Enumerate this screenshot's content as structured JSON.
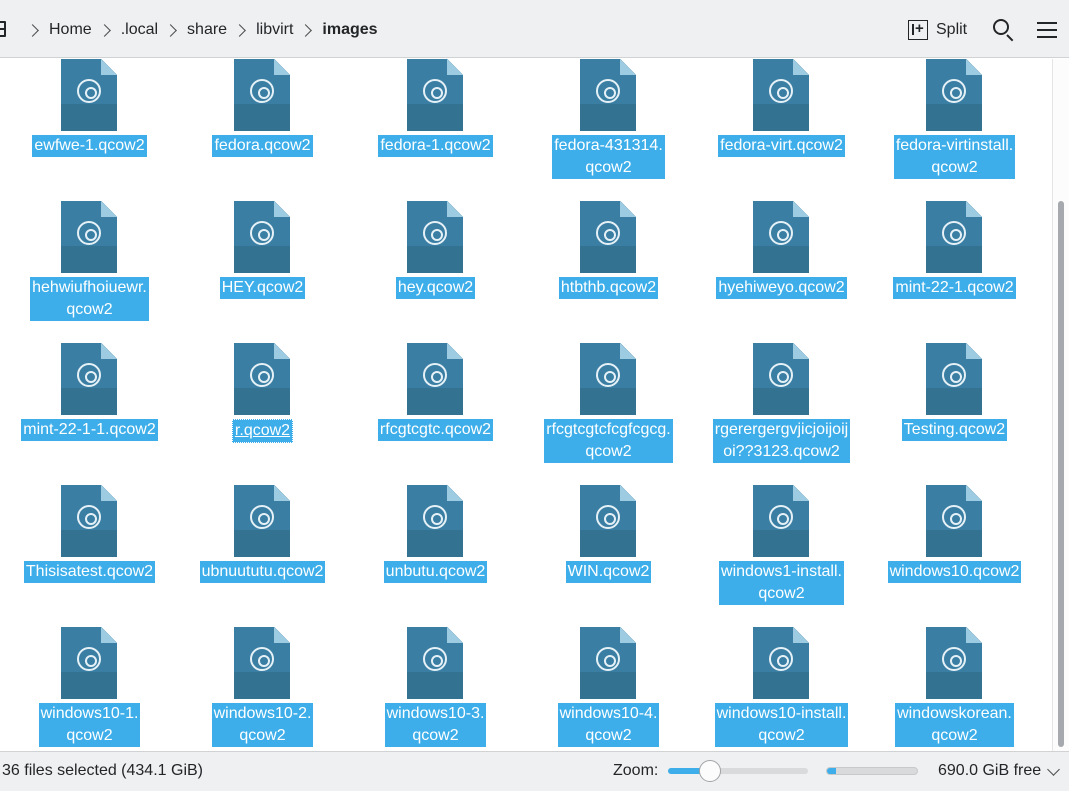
{
  "breadcrumb": {
    "items": [
      "Home",
      ".local",
      "share",
      "libvirt",
      "images"
    ]
  },
  "toolbar": {
    "split_label": "Split"
  },
  "files": [
    {
      "name": "ewfwe-1.qcow2"
    },
    {
      "name": "fedora.qcow2"
    },
    {
      "name": "fedora-1.qcow2"
    },
    {
      "name": "fedora-431314.\nqcow2"
    },
    {
      "name": "fedora-virt.qcow2"
    },
    {
      "name": "fedora-virtinstall.\nqcow2"
    },
    {
      "name": "hehwiufhoiuewr.\nqcow2"
    },
    {
      "name": "HEY.qcow2"
    },
    {
      "name": "hey.qcow2"
    },
    {
      "name": "htbthb.qcow2"
    },
    {
      "name": "hyehiweyo.qcow2"
    },
    {
      "name": "mint-22-1.qcow2"
    },
    {
      "name": "mint-22-1-1.qcow2"
    },
    {
      "name": "r.qcow2",
      "focused": true
    },
    {
      "name": "rfcgtcgtc.qcow2"
    },
    {
      "name": "rfcgtcgtcfcgfcgcg.\nqcow2"
    },
    {
      "name": "rgerergergvjicjoijoij\noi??3123.qcow2"
    },
    {
      "name": "Testing.qcow2"
    },
    {
      "name": "Thisisatest.qcow2"
    },
    {
      "name": "ubnuututu.qcow2"
    },
    {
      "name": "unbutu.qcow2"
    },
    {
      "name": "WIN.qcow2"
    },
    {
      "name": "windows1-install.\nqcow2"
    },
    {
      "name": "windows10.qcow2"
    },
    {
      "name": "windows10-1.\nqcow2"
    },
    {
      "name": "windows10-2.\nqcow2"
    },
    {
      "name": "windows10-3.\nqcow2"
    },
    {
      "name": "windows10-4.\nqcow2"
    },
    {
      "name": "windows10-install.\nqcow2"
    },
    {
      "name": "windowskorean.\nqcow2"
    }
  ],
  "statusbar": {
    "selection_text": "36 files selected (434.1 GiB)",
    "zoom_label": "Zoom:",
    "zoom_level": 0.3,
    "space_used_fraction": 0.1,
    "free_space_text": "690.0 GiB free"
  },
  "colors": {
    "selection": "#3daee9",
    "file_icon": "#3a7fa3"
  },
  "icons": {
    "file": "disc-image-file-icon",
    "search": "search-icon",
    "menu": "hamburger-menu-icon",
    "split": "split-view-icon"
  }
}
